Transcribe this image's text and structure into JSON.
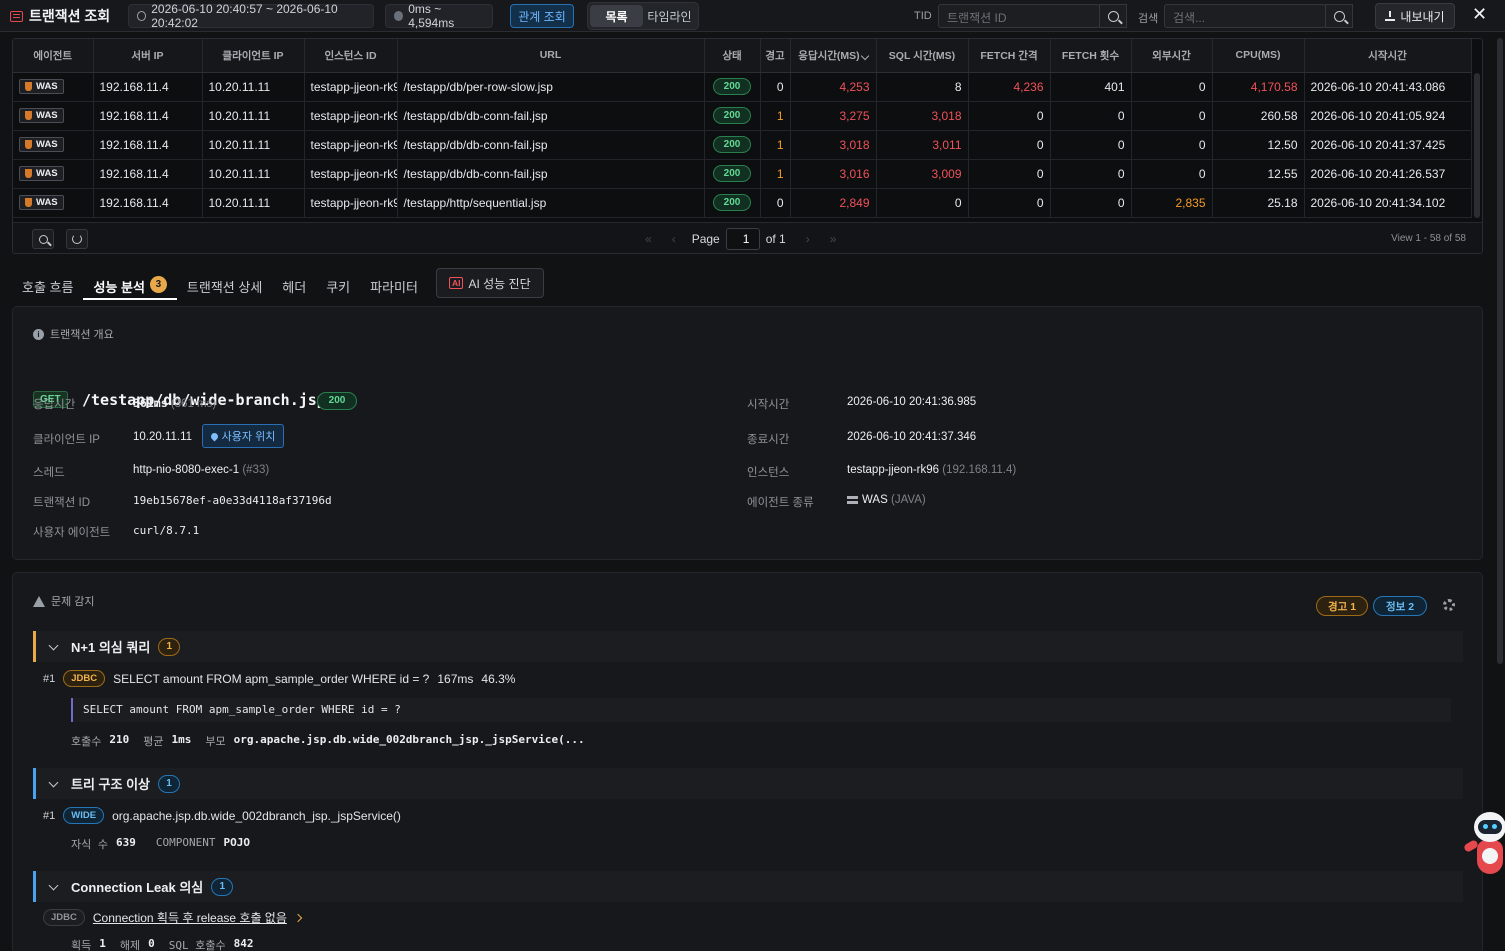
{
  "topbar": {
    "title": "트랜잭션 조회",
    "time_range": "2026-06-10 20:40:57 ~ 2026-06-10 20:42:02",
    "duration_range": "0ms ~ 4,594ms",
    "relation_button": "관계 조회",
    "view_list": "목록",
    "view_timeline": "타임라인",
    "tid_label": "TID",
    "tid_placeholder": "트랜잭션 ID",
    "search_label": "검색",
    "search_placeholder": "검색...",
    "export_label": "내보내기",
    "close_label": "✕"
  },
  "table": {
    "columns": [
      "에이전트",
      "서버 IP",
      "클라이언트 IP",
      "인스턴스 ID",
      "URL",
      "상태",
      "경고",
      "응답시간(MS)",
      "SQL 시간(MS)",
      "FETCH 간격",
      "FETCH 횟수",
      "외부시간",
      "CPU(MS)",
      "시작시간"
    ],
    "rows": [
      {
        "agent": "WAS",
        "server_ip": "192.168.11.4",
        "client_ip": "10.20.11.11",
        "instance": "testapp-jjeon-rk9",
        "url": "/testapp/db/per-row-slow.jsp",
        "status": "200",
        "warn": "0",
        "resp": "4,253",
        "sql": "8",
        "fetch_gap": "4,236",
        "fetch_cnt": "401",
        "ext": "0",
        "cpu": "4,170.58",
        "start": "2026-06-10 20:41:43.086"
      },
      {
        "agent": "WAS",
        "server_ip": "192.168.11.4",
        "client_ip": "10.20.11.11",
        "instance": "testapp-jjeon-rk9",
        "url": "/testapp/db/db-conn-fail.jsp",
        "status": "200",
        "warn": "1",
        "resp": "3,275",
        "sql": "3,018",
        "fetch_gap": "0",
        "fetch_cnt": "0",
        "ext": "0",
        "cpu": "260.58",
        "start": "2026-06-10 20:41:05.924"
      },
      {
        "agent": "WAS",
        "server_ip": "192.168.11.4",
        "client_ip": "10.20.11.11",
        "instance": "testapp-jjeon-rk9",
        "url": "/testapp/db/db-conn-fail.jsp",
        "status": "200",
        "warn": "1",
        "resp": "3,018",
        "sql": "3,011",
        "fetch_gap": "0",
        "fetch_cnt": "0",
        "ext": "0",
        "cpu": "12.50",
        "start": "2026-06-10 20:41:37.425"
      },
      {
        "agent": "WAS",
        "server_ip": "192.168.11.4",
        "client_ip": "10.20.11.11",
        "instance": "testapp-jjeon-rk9",
        "url": "/testapp/db/db-conn-fail.jsp",
        "status": "200",
        "warn": "1",
        "resp": "3,016",
        "sql": "3,009",
        "fetch_gap": "0",
        "fetch_cnt": "0",
        "ext": "0",
        "cpu": "12.55",
        "start": "2026-06-10 20:41:26.537"
      },
      {
        "agent": "WAS",
        "server_ip": "192.168.11.4",
        "client_ip": "10.20.11.11",
        "instance": "testapp-jjeon-rk9",
        "url": "/testapp/http/sequential.jsp",
        "status": "200",
        "warn": "0",
        "resp": "2,849",
        "sql": "0",
        "fetch_gap": "0",
        "fetch_cnt": "0",
        "ext": "2,835",
        "cpu": "25.18",
        "start": "2026-06-10 20:41:34.102"
      }
    ],
    "pager": {
      "page_label": "Page",
      "page_value": "1",
      "of_label": "of 1",
      "view_text": "View 1 - 58 of 58"
    }
  },
  "tabs": {
    "call_flow": "호출 흐름",
    "perf_analysis": "성능 분석",
    "perf_badge": "3",
    "tx_detail": "트랜잭션 상세",
    "header": "헤더",
    "cookie": "쿠키",
    "param": "파라미터",
    "ai_icon": "AI",
    "ai_label": "AI 성능 진단"
  },
  "overview": {
    "heading": "트랜잭션 개요",
    "method": "GET",
    "url": "/testapp/db/wide-branch.jsp",
    "status": "200",
    "resp_label": "응답시간",
    "resp_value": "361ms",
    "resp_sub": "(361 ms)",
    "client_label": "클라이언트 IP",
    "client_value": "10.20.11.11",
    "location_btn": "사용자 위치",
    "thread_label": "스레드",
    "thread_value": "http-nio-8080-exec-1",
    "thread_sub": "(#33)",
    "txid_label": "트랜잭션 ID",
    "txid_value": "19eb15678ef-a0e33d4118af37196d",
    "ua_label": "사용자 에이전트",
    "ua_value": "curl/8.7.1",
    "start_label": "시작시간",
    "start_value": "2026-06-10 20:41:36.985",
    "end_label": "종료시간",
    "end_value": "2026-06-10 20:41:37.346",
    "instance_label": "인스턴스",
    "instance_value": "testapp-jjeon-rk96",
    "instance_sub": "(192.168.11.4)",
    "agent_label": "에이전트 종류",
    "agent_value": "WAS",
    "agent_sub": "(JAVA)"
  },
  "problems": {
    "heading": "문제 감지",
    "warn_chip": "경고 1",
    "info_chip": "정보 2",
    "n1": {
      "title": "N+1 의심 쿼리",
      "count": "1",
      "idx": "#1",
      "tag": "JDBC",
      "sql": "SELECT amount FROM apm_sample_order WHERE id = ?",
      "time": "167ms",
      "pct": "46.3%",
      "code": "SELECT amount FROM apm_sample_order WHERE id = ?",
      "calls_label": "호출수",
      "calls_value": "210",
      "avg_label": "평균",
      "avg_value": "1ms",
      "parent_label": "부모",
      "parent_value": "org.apache.jsp.db.wide_002dbranch_jsp._jspService(..."
    },
    "tree": {
      "title": "트리 구조 이상",
      "count": "1",
      "idx": "#1",
      "tag": "WIDE",
      "method": "org.apache.jsp.db.wide_002dbranch_jsp._jspService()",
      "children_label": "자식 수",
      "children_value": "639",
      "component_label": "COMPONENT",
      "component_value": "POJO"
    },
    "leak": {
      "title": "Connection Leak 의심",
      "count": "1",
      "tag": "JDBC",
      "desc": "Connection 획득 후 release 호출 없음",
      "acquire_label": "획득",
      "acquire_value": "1",
      "release_label": "해제",
      "release_value": "0",
      "sql_label": "SQL 호출수",
      "sql_value": "842"
    }
  }
}
